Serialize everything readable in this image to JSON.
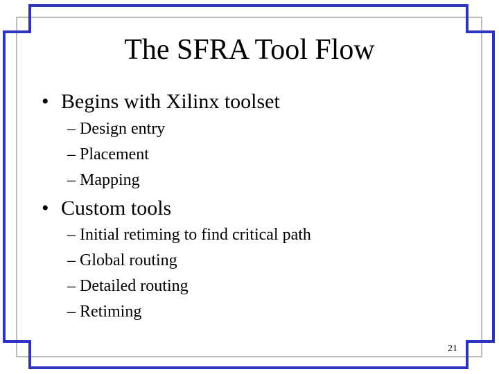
{
  "slide": {
    "title": "The SFRA Tool Flow",
    "number": "21",
    "bullets": [
      {
        "marker": "•",
        "text": "Begins with Xilinx toolset",
        "subitems": [
          "– Design entry",
          "– Placement",
          "– Mapping"
        ]
      },
      {
        "marker": "•",
        "text": "Custom tools",
        "subitems": [
          "– Initial retiming to find critical path",
          "– Global routing",
          "– Detailed routing",
          "– Retiming"
        ]
      }
    ]
  },
  "colors": {
    "frame_blue": "#2e33c0",
    "frame_gray": "#a7a7a7",
    "background": "#ffffff",
    "text": "#000000"
  }
}
